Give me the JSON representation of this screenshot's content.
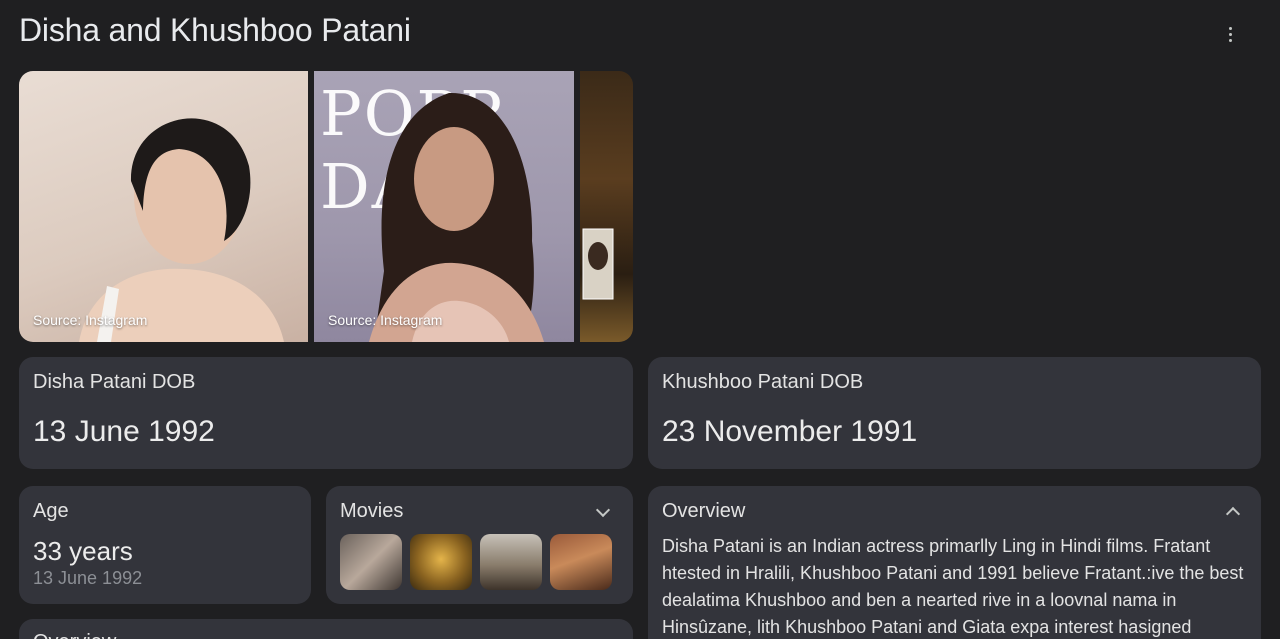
{
  "page": {
    "title": "Disha and Khushboo Patani"
  },
  "menu": {
    "icon": "more-vert-icon"
  },
  "gallery": {
    "images": [
      {
        "source": "Source: Instagram"
      },
      {
        "source": "Source: Instagram",
        "cover_title": "POPP DAP"
      },
      {
        "source": ""
      }
    ]
  },
  "cards": {
    "disha_dob": {
      "label": "Disha Patani DOB",
      "value": "13 June 1992"
    },
    "khushboo_dob": {
      "label": "Khushboo Patani DOB",
      "value": "23 November 1991"
    },
    "age": {
      "label": "Age",
      "value": "33 years",
      "sub": "13 June 1992"
    },
    "movies": {
      "label": "Movies",
      "icon": "chevron-down-icon",
      "thumbnails": 4
    },
    "overview": {
      "label": "Overview",
      "icon": "chevron-up-icon",
      "text": "Disha Patani is an Indian actress primarlly Ling in Hindi films. Fratant htested in Hralili, Khushboo Patani and 1991 believe Fratant.:ive the best dealatima Khushboo and ben a nearted rive in a loovnal nama in Hinsûzane, lith Khushboo Patani and Giata expa interest hasigned"
    },
    "bottom": {
      "label": "Overview"
    }
  },
  "colors": {
    "background": "#1f1f21",
    "card": "#33343b",
    "text": "#e8eaed",
    "muted": "#8c8f95"
  }
}
